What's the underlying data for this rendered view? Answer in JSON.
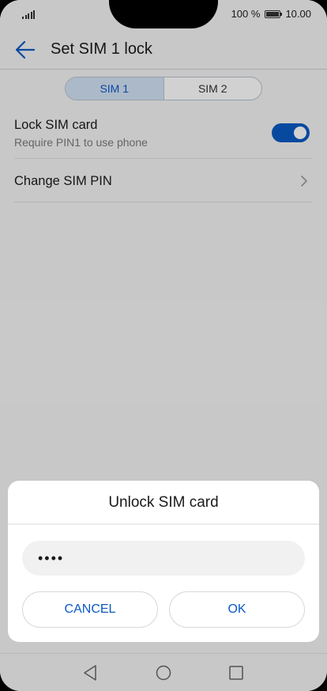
{
  "status_bar": {
    "battery_text": "100 %",
    "time": "10.00"
  },
  "app_bar": {
    "title": "Set SIM 1 lock",
    "back_icon": "arrow-left-icon"
  },
  "sim_tabs": [
    {
      "label": "SIM 1",
      "active": true
    },
    {
      "label": "SIM 2",
      "active": false
    }
  ],
  "settings": {
    "lock_sim": {
      "title": "Lock SIM card",
      "subtitle": "Require PIN1 to use phone",
      "enabled": true
    },
    "change_pin": {
      "title": "Change SIM PIN"
    }
  },
  "dialog": {
    "title": "Unlock SIM card",
    "pin_value": "••••",
    "cancel_label": "CANCEL",
    "ok_label": "OK"
  },
  "colors": {
    "accent": "#0a59c4",
    "tab_active_bg": "#d2e2f4"
  },
  "nav_bar": {
    "icons": [
      "back-triangle-icon",
      "home-circle-icon",
      "recents-square-icon"
    ]
  }
}
